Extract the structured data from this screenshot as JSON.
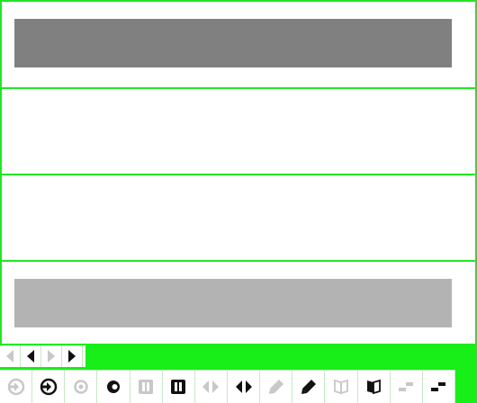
{
  "colors": {
    "frame_border": "#22e622",
    "bottom_background": "#18ee18",
    "bar_dark": "#808080",
    "bar_light": "#b3b3b3",
    "icon_active": "#111111",
    "icon_inactive": "#c8c8c8"
  },
  "panels": [
    {
      "name": "panel-1",
      "content": "dark-bar"
    },
    {
      "name": "panel-2",
      "content": "empty"
    },
    {
      "name": "panel-3",
      "content": "empty"
    },
    {
      "name": "panel-4",
      "content": "light-bar"
    }
  ],
  "nav": {
    "buttons": [
      {
        "name": "scroll-left-disabled-icon",
        "state": "disabled"
      },
      {
        "name": "scroll-left-icon",
        "state": "enabled"
      },
      {
        "name": "scroll-right-disabled-icon",
        "state": "disabled"
      },
      {
        "name": "scroll-right-icon",
        "state": "enabled"
      }
    ]
  },
  "toolbar": {
    "buttons": [
      {
        "icon": "arrow-circle-disabled-icon",
        "state": "disabled"
      },
      {
        "icon": "arrow-circle-icon",
        "state": "enabled"
      },
      {
        "icon": "ring-disabled-icon",
        "state": "disabled"
      },
      {
        "icon": "ring-icon",
        "state": "enabled"
      },
      {
        "icon": "pause-disabled-icon",
        "state": "disabled"
      },
      {
        "icon": "pause-icon",
        "state": "enabled"
      },
      {
        "icon": "left-right-disabled-icon",
        "state": "disabled"
      },
      {
        "icon": "left-right-icon",
        "state": "enabled"
      },
      {
        "icon": "pencil-disabled-icon",
        "state": "disabled"
      },
      {
        "icon": "pencil-icon",
        "state": "enabled"
      },
      {
        "icon": "book-disabled-icon",
        "state": "disabled"
      },
      {
        "icon": "book-icon",
        "state": "enabled"
      },
      {
        "icon": "steps-disabled-icon",
        "state": "disabled"
      },
      {
        "icon": "steps-icon",
        "state": "enabled"
      }
    ]
  }
}
